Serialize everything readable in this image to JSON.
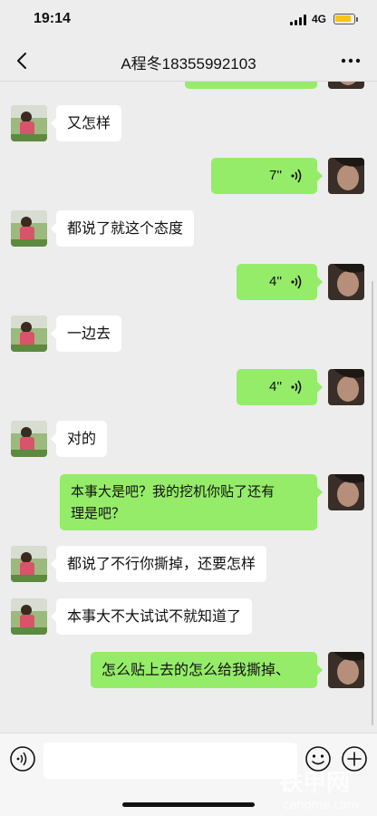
{
  "status_bar": {
    "time": "19:14",
    "network": "4G"
  },
  "header": {
    "title": "A程冬18355992103",
    "back_icon": "chevron-left-icon",
    "more_icon": "more-dots-icon"
  },
  "messages": [
    {
      "from": "me",
      "type": "partial"
    },
    {
      "from": "other",
      "type": "text",
      "text": "又怎样"
    },
    {
      "from": "me",
      "type": "voice",
      "duration": "7''"
    },
    {
      "from": "other",
      "type": "text",
      "text": "都说了就这个态度"
    },
    {
      "from": "me",
      "type": "voice",
      "duration": "4''"
    },
    {
      "from": "other",
      "type": "text",
      "text": "一边去"
    },
    {
      "from": "me",
      "type": "voice",
      "duration": "4''"
    },
    {
      "from": "other",
      "type": "text",
      "text": "对的"
    },
    {
      "from": "me",
      "type": "text",
      "line1": "本事大是吧？我的挖机你贴了还有",
      "line2": "理是吧？"
    },
    {
      "from": "other",
      "type": "text",
      "text": "都说了不行你撕掉，还要怎样"
    },
    {
      "from": "other",
      "type": "text",
      "text": "本事大不大试试不就知道了"
    },
    {
      "from": "me",
      "type": "text",
      "text": "怎么贴上去的怎么给我撕掉、"
    }
  ],
  "input_bar": {
    "voice_icon": "voice-mode-icon",
    "emoji_icon": "emoji-icon",
    "plus_icon": "plus-icon",
    "input_value": ""
  },
  "watermark": {
    "text": "铁甲网",
    "sub": "cehome.com"
  },
  "colors": {
    "background": "#ededed",
    "outgoing_bubble": "#95ec69",
    "incoming_bubble": "#ffffff"
  }
}
